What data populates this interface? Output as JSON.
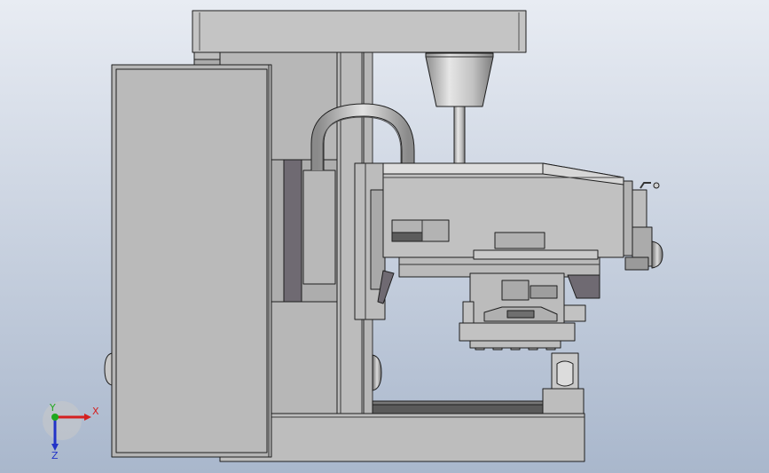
{
  "viewport": {
    "background_top": "#e8ecf3",
    "background_bottom": "#a9b7cc"
  },
  "model_colors": {
    "body": "#b9b9b9",
    "body_light": "#cfcfcf",
    "body_dark": "#9a9a9a",
    "edge": "#1e1e1e",
    "shadow": "#6f6a72",
    "dark_block": "#5c5c5c"
  },
  "triad": {
    "x_label": "X",
    "y_label": "Y",
    "z_label": "Z",
    "x_color": "#d42020",
    "y_color": "#1fa81f",
    "z_color": "#2233c8"
  }
}
